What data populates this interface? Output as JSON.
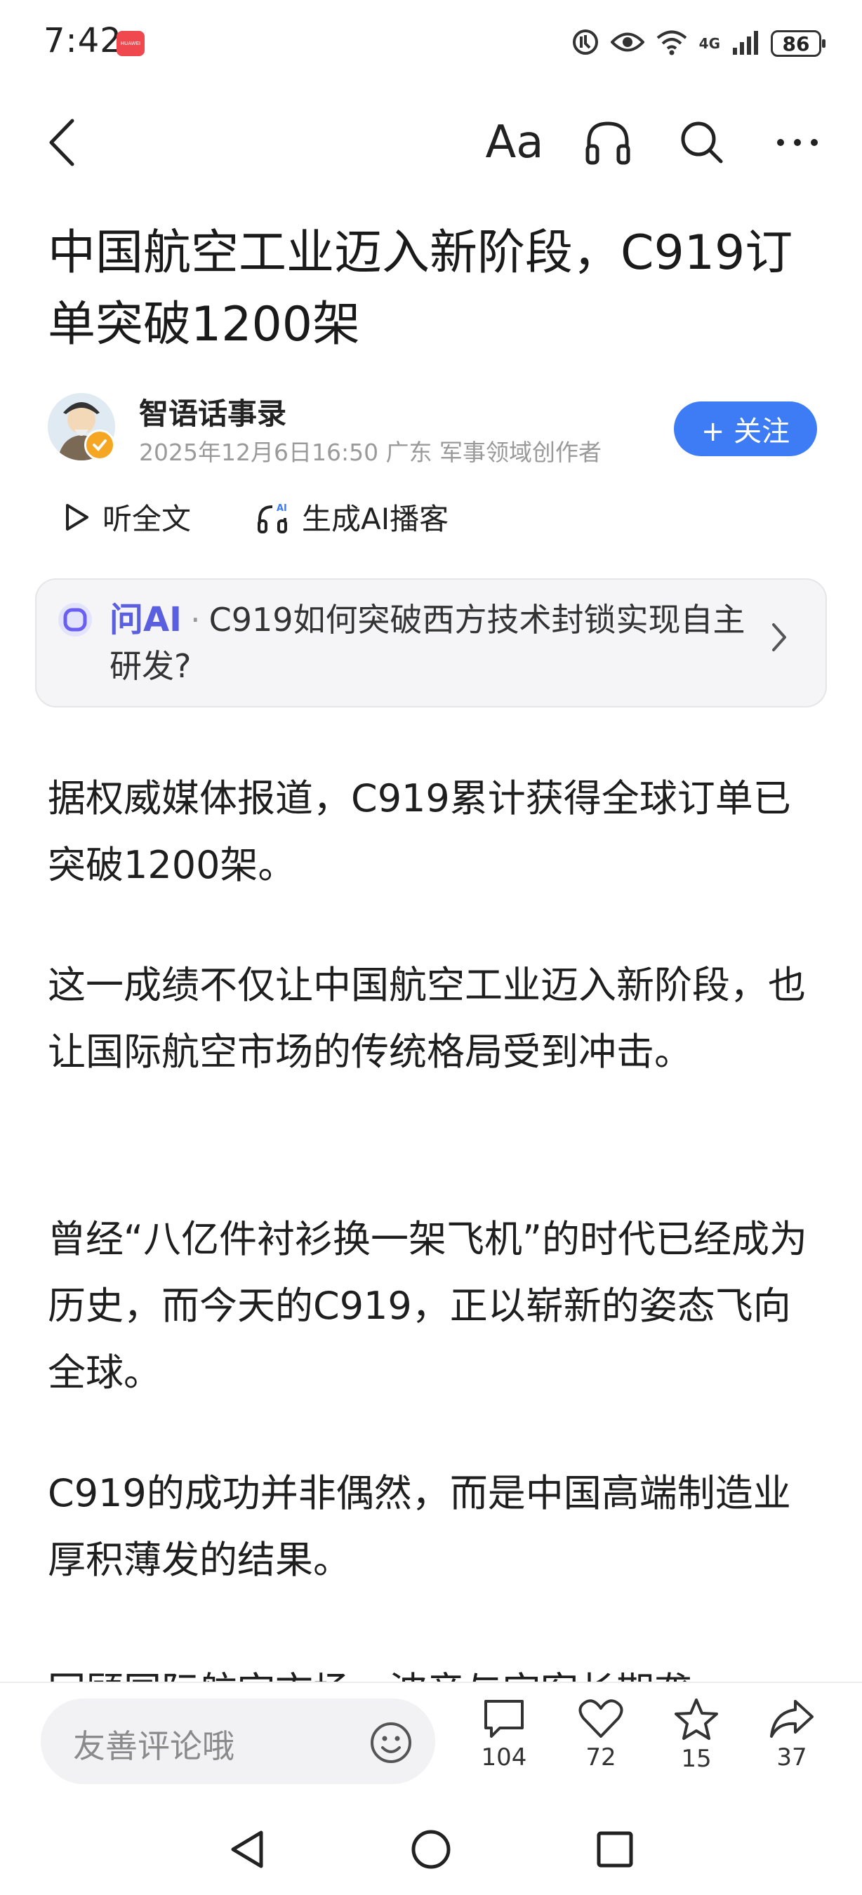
{
  "status_bar": {
    "time": "7:42",
    "brand_badge": "HUAWEI",
    "network": "4G",
    "battery": "86"
  },
  "nav": {
    "font_icon_label": "Aa"
  },
  "article": {
    "title": "中国航空工业迈入新阶段，C919订单突破1200架",
    "author": {
      "name": "智语话事录",
      "meta": "2025年12月6日16:50 广东 军事领域创作者"
    },
    "follow_label": "+ 关注",
    "listen_label": "听全文",
    "podcast_label": "生成AI播客",
    "ai_prompt": {
      "label": "问AI",
      "separator": "·",
      "question": "C919如何突破西方技术封锁实现自主研发?"
    },
    "paragraphs": [
      "据权威媒体报道，C919累计获得全球订单已突破1200架。",
      "这一成绩不仅让中国航空工业迈入新阶段，也让国际航空市场的传统格局受到冲击。",
      "曾经“八亿件衬衫换一架飞机”的时代已经成为历史，而今天的C919，正以崭新的姿态飞向全球。",
      "C919的成功并非偶然，而是中国高端制造业厚积薄发的结果。",
      "回顾国际航空市场，波音与空客长期垄"
    ]
  },
  "bottom_bar": {
    "comment_placeholder": "友善评论哦",
    "comments": "104",
    "likes": "72",
    "favorites": "15",
    "shares": "37"
  },
  "colors": {
    "accent": "#3d7cf5",
    "ai_purple": "#5a5fe0",
    "meta_gray": "#9a9a9a"
  }
}
